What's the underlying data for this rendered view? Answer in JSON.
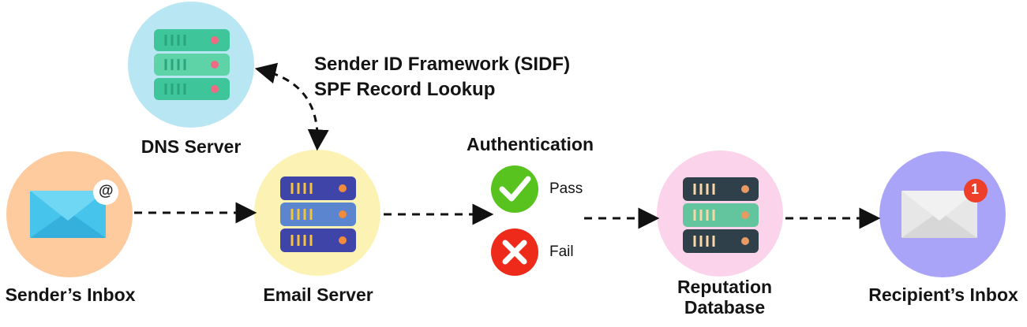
{
  "nodes": {
    "dns_server": "DNS Server",
    "sender_inbox": "Sender’s Inbox",
    "email_server": "Email Server",
    "reputation_database_line1": "Reputation",
    "reputation_database_line2": "Database",
    "recipient_inbox": "Recipient’s Inbox"
  },
  "annotation": {
    "line1": "Sender ID Framework (SIDF)",
    "line2": "SPF Record Lookup"
  },
  "authentication": {
    "title": "Authentication",
    "pass": "Pass",
    "fail": "Fail"
  },
  "badges": {
    "at_symbol": "@",
    "notification_count": "1"
  },
  "icons": [
    "server-icon",
    "email-envelope-icon",
    "database-icon",
    "check-icon",
    "cross-icon"
  ],
  "colors": {
    "dns_circle": "#b9e6f3",
    "sender_circle": "#fdcb9e",
    "email_circle": "#fbf2b4",
    "reputation_circle": "#fbd3ea",
    "recipient_circle": "#a9a4f7",
    "pass_green": "#58c21f",
    "fail_red": "#ee2b1a"
  }
}
